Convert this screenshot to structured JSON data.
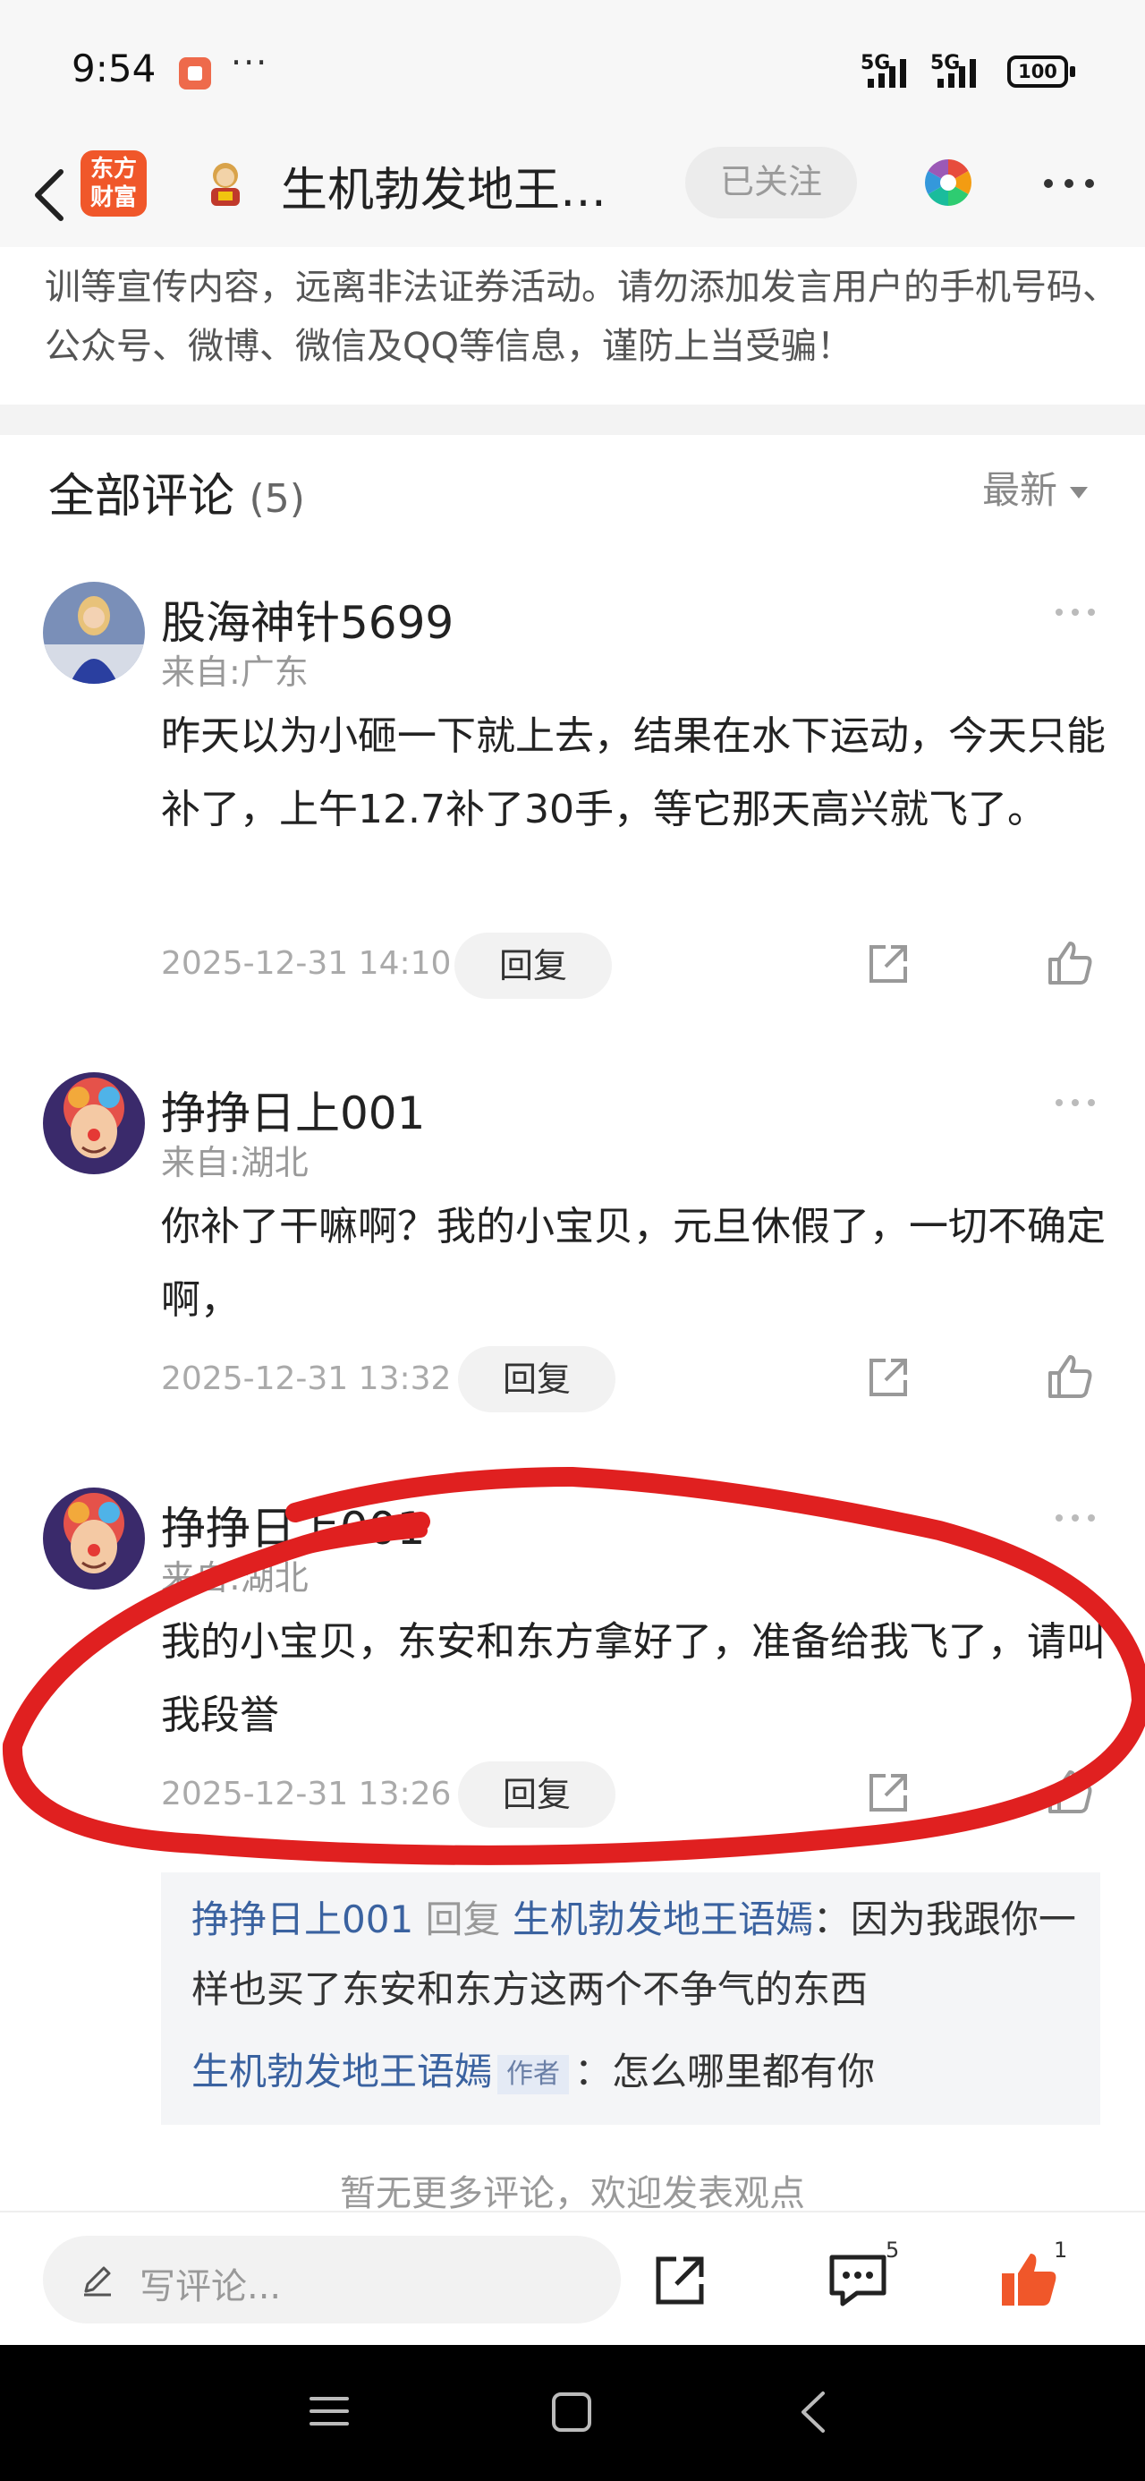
{
  "status_bar": {
    "time": "9:54",
    "signal_1": "5G",
    "signal_2": "5G",
    "battery": "100",
    "overflow": "···"
  },
  "navbar": {
    "app_logo_line1": "东方",
    "app_logo_line2": "财富",
    "title": "生机勃发地王…",
    "follow_label": "已关注"
  },
  "warning_text": "训等宣传内容，远离非法证券活动。请勿添加发言用户的手机号码、公众号、微博、微信及QQ等信息，谨防上当受骗！",
  "comments_header": {
    "title": "全部评论",
    "count": "(5)",
    "sort_label": "最新"
  },
  "comments": [
    {
      "name": "股海神针5699",
      "location": "来自:广东",
      "text": "昨天以为小砸一下就上去，结果在水下运动，今天只能补了，上午12.7补了30手，等它那天高兴就飞了。",
      "time": "2025-12-31 14:10",
      "reply_label": "回复"
    },
    {
      "name": "挣挣日上001",
      "location": "来自:湖北",
      "text": "你补了干嘛啊？我的小宝贝，元旦休假了，一切不确定啊，",
      "time": "2025-12-31 13:32",
      "reply_label": "回复"
    },
    {
      "name": "挣挣日上001",
      "location": "来自:湖北",
      "text": "我的小宝贝，东安和东方拿好了，准备给我飞了，请叫我段誉",
      "time": "2025-12-31 13:26",
      "reply_label": "回复"
    }
  ],
  "sub_replies": [
    {
      "from": "挣挣日上001",
      "verb": "回复",
      "to": "生机勃发地王语嫣",
      "text": "：因为我跟你一样也买了东安和东方这两个不争气的东西"
    },
    {
      "from": "生机勃发地王语嫣",
      "tag": "作者",
      "text": "：怎么哪里都有你"
    }
  ],
  "no_more": "暂无更多评论，欢迎发表观点",
  "bottom_bar": {
    "placeholder": "写评论...",
    "comment_count": "5",
    "like_count": "1"
  },
  "colors": {
    "accent": "#f0572a",
    "link_blue": "#3a62a0",
    "annotation_red": "#e02020"
  }
}
